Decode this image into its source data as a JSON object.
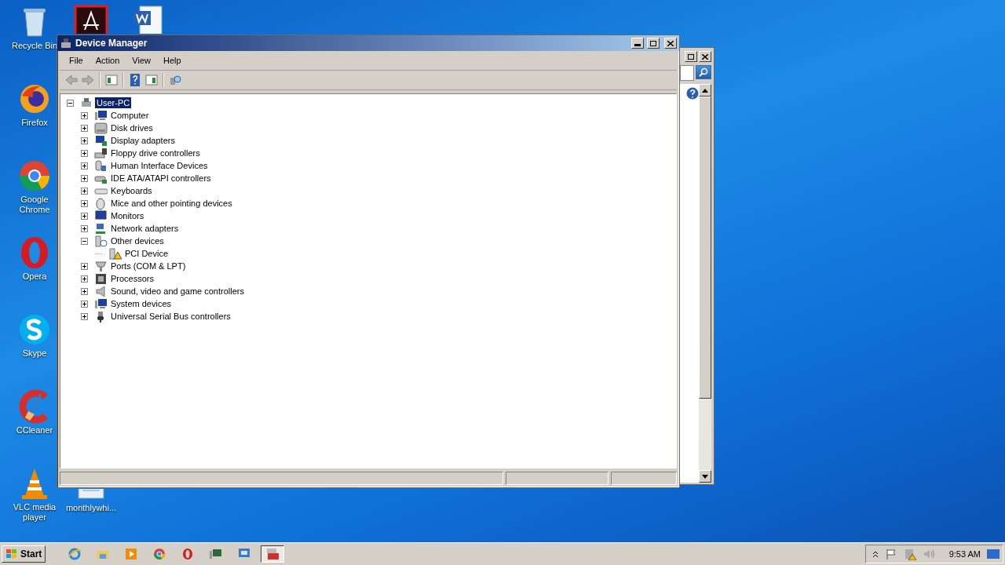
{
  "desktop_icons": [
    {
      "kind": "recycle",
      "label": "Recycle Bin"
    },
    {
      "kind": "acrobat"
    },
    {
      "kind": "word"
    },
    {
      "kind": "firefox",
      "label": "Firefox"
    },
    {
      "kind": "chrome",
      "label": "Google Chrome"
    },
    {
      "kind": "opera",
      "label": "Opera"
    },
    {
      "kind": "skype",
      "label": "Skype"
    },
    {
      "kind": "ccleaner",
      "label": "CCleaner"
    },
    {
      "kind": "vlc",
      "label": "VLC media player"
    },
    {
      "kind": "document",
      "label": "monthlywhi..."
    }
  ],
  "window": {
    "title": "Device Manager",
    "menu": [
      "File",
      "Action",
      "View",
      "Help"
    ],
    "tree": {
      "label": "User-PC",
      "kind": "pc",
      "selected": true,
      "expanded": true,
      "children": [
        {
          "label": "Computer",
          "kind": "computer",
          "expanded": false
        },
        {
          "label": "Disk drives",
          "kind": "disk",
          "expanded": false
        },
        {
          "label": "Display adapters",
          "kind": "display",
          "expanded": false
        },
        {
          "label": "Floppy drive controllers",
          "kind": "floppy",
          "expanded": false
        },
        {
          "label": "Human Interface Devices",
          "kind": "hid",
          "expanded": false
        },
        {
          "label": "IDE ATA/ATAPI controllers",
          "kind": "ide",
          "expanded": false
        },
        {
          "label": "Keyboards",
          "kind": "keyboard",
          "expanded": false
        },
        {
          "label": "Mice and other pointing devices",
          "kind": "mouse",
          "expanded": false
        },
        {
          "label": "Monitors",
          "kind": "monitor",
          "expanded": false
        },
        {
          "label": "Network adapters",
          "kind": "network",
          "expanded": false
        },
        {
          "label": "Other devices",
          "kind": "unknown",
          "expanded": true,
          "children": [
            {
              "label": "PCI Device",
              "kind": "warning"
            }
          ]
        },
        {
          "label": "Ports (COM & LPT)",
          "kind": "port",
          "expanded": false
        },
        {
          "label": "Processors",
          "kind": "cpu",
          "expanded": false
        },
        {
          "label": "Sound, video and game controllers",
          "kind": "sound",
          "expanded": false
        },
        {
          "label": "System devices",
          "kind": "computer",
          "expanded": false
        },
        {
          "label": "Universal Serial Bus controllers",
          "kind": "usb",
          "expanded": false
        }
      ]
    }
  },
  "taskbar": {
    "start": "Start",
    "items": [
      {
        "kind": "ie",
        "selected": false
      },
      {
        "kind": "folder",
        "selected": false
      },
      {
        "kind": "media",
        "selected": false
      },
      {
        "kind": "chrome",
        "selected": false
      },
      {
        "kind": "opera",
        "selected": false
      },
      {
        "kind": "devmgr",
        "selected": false
      },
      {
        "kind": "remote",
        "selected": false
      },
      {
        "kind": "toolbox",
        "selected": true
      }
    ],
    "clock": "9:53 AM"
  }
}
